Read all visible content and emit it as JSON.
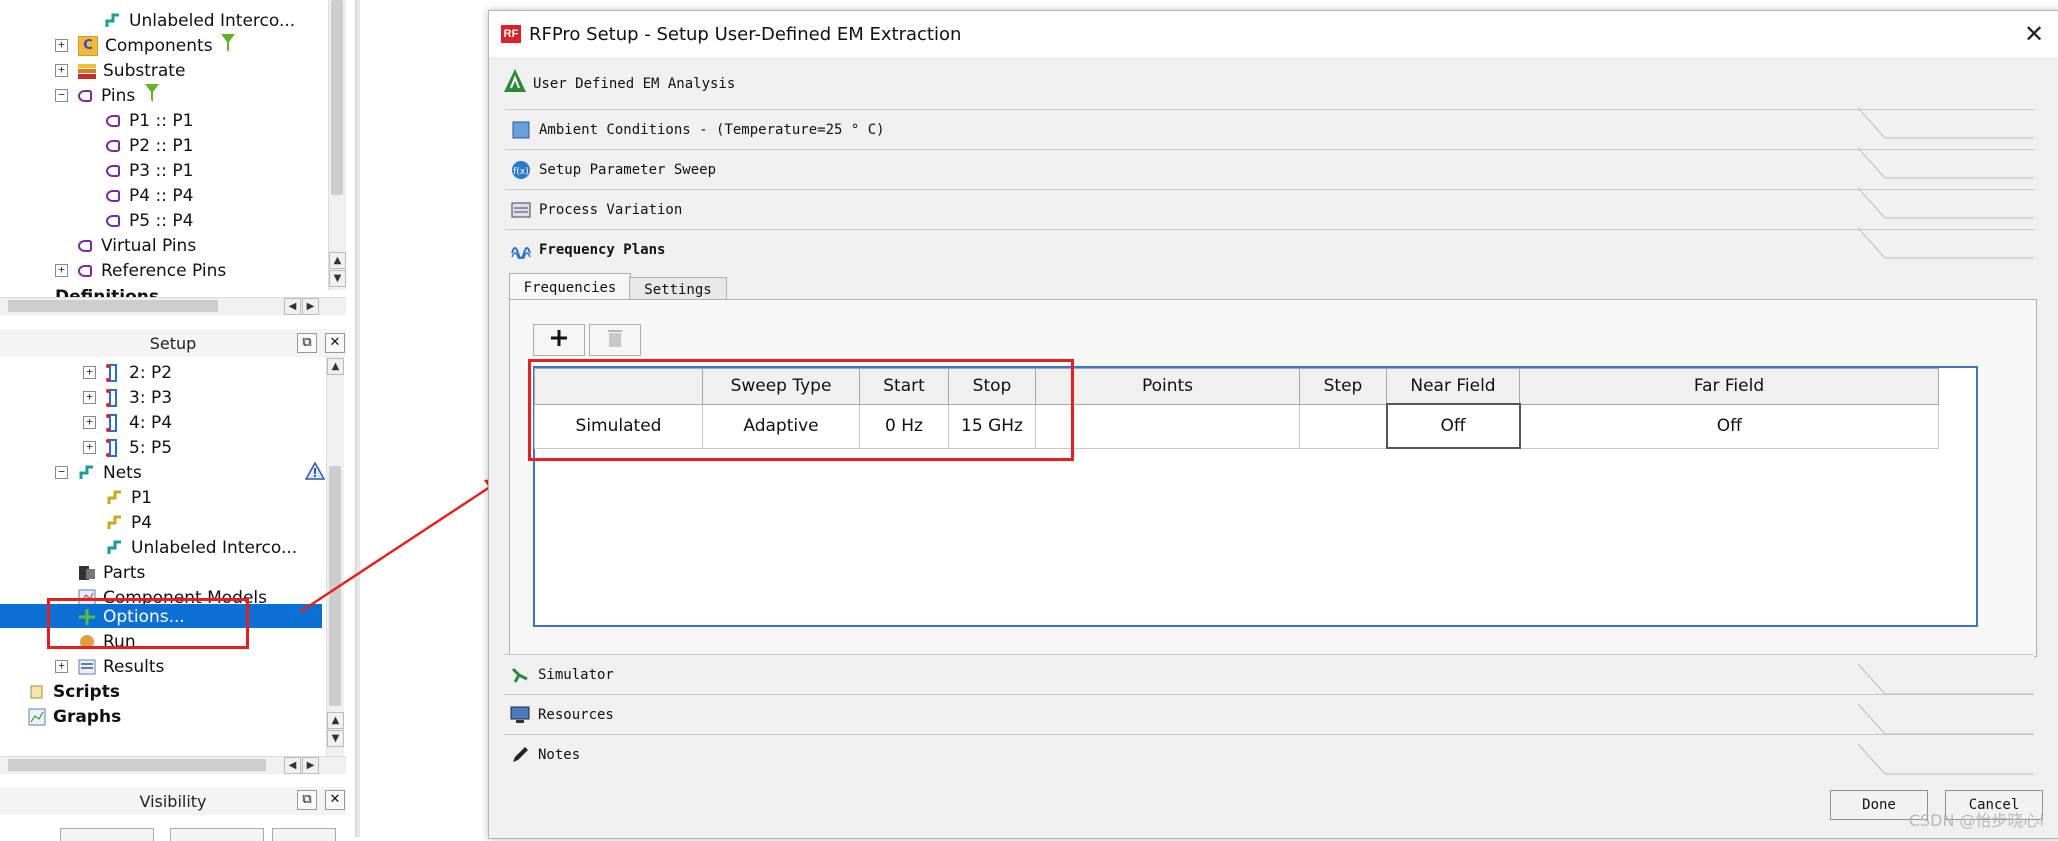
{
  "tree_top": {
    "items": [
      {
        "label": "Unlabeled Interco..."
      },
      {
        "label": "Components"
      },
      {
        "label": "Substrate"
      },
      {
        "label": "Pins"
      },
      {
        "label": "P1 :: P1"
      },
      {
        "label": "P2 :: P1"
      },
      {
        "label": "P3 :: P1"
      },
      {
        "label": "P4 :: P4"
      },
      {
        "label": "P5 :: P4"
      },
      {
        "label": "Virtual Pins"
      },
      {
        "label": "Reference Pins"
      },
      {
        "label": "Definitions"
      }
    ]
  },
  "setup_panel": {
    "title": "Setup",
    "items": [
      {
        "label": "2: P2"
      },
      {
        "label": "3: P3"
      },
      {
        "label": "4: P4"
      },
      {
        "label": "5: P5"
      },
      {
        "label": "Nets"
      },
      {
        "label": "P1"
      },
      {
        "label": "P4"
      },
      {
        "label": "Unlabeled Interco..."
      },
      {
        "label": "Parts"
      },
      {
        "label": "Component Models"
      },
      {
        "label": "Options..."
      },
      {
        "label": "Run"
      },
      {
        "label": "Results"
      },
      {
        "label": "Scripts"
      },
      {
        "label": "Graphs"
      }
    ]
  },
  "visibility_panel": {
    "title": "Visibility"
  },
  "dialog": {
    "logo": "RF",
    "title": "RFPro Setup - Setup User-Defined EM Extraction",
    "analysis_label": "User Defined EM Analysis",
    "sections": {
      "ambient": "Ambient Conditions - (Temperature=25 ° C)",
      "sweep": "Setup Parameter Sweep",
      "process": "Process Variation",
      "frequency": "Frequency Plans",
      "simulator": "Simulator",
      "resources": "Resources",
      "notes": "Notes"
    },
    "tabs": [
      "Frequencies",
      "Settings"
    ],
    "table": {
      "headers": [
        "",
        "Sweep Type",
        "Start",
        "Stop",
        "Points",
        "Step",
        "Near Field",
        "Far Field"
      ],
      "rows": [
        [
          "Simulated",
          "Adaptive",
          "0 Hz",
          "15 GHz",
          "",
          "",
          "Off",
          "Off"
        ]
      ]
    },
    "buttons": {
      "done": "Done",
      "cancel": "Cancel"
    }
  },
  "watermark": "CSDN @怡步晓心l",
  "colors": {
    "selection": "#0c6fd6",
    "highlight": "#e52020",
    "rf_logo": "#d8232a"
  }
}
